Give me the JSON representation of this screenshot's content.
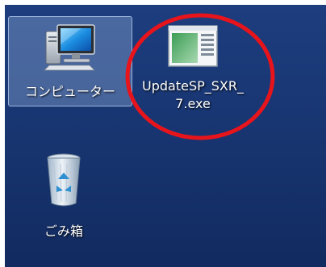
{
  "desktop": {
    "background_color": "#17346f",
    "icons": [
      {
        "label": "コンピューター",
        "icon": "computer-icon",
        "selected": true
      },
      {
        "label_line1": "UpdateSP_SXR_",
        "label_line2": "7.exe",
        "icon": "exe-window-icon",
        "selected": false
      },
      {
        "label": "ごみ箱",
        "icon": "recycle-bin-icon",
        "selected": false
      }
    ]
  },
  "annotation": {
    "shape": "ellipse",
    "color": "#e8141c",
    "target": "UpdateSP_SXR_7.exe"
  }
}
